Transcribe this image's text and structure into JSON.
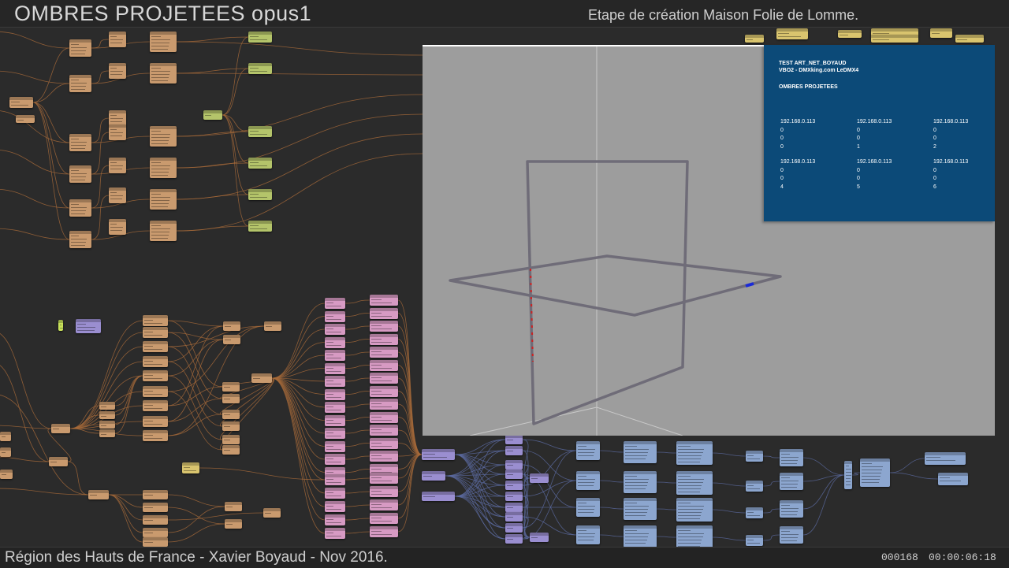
{
  "header": {
    "title": "OMBRES PROJETEES  opus1",
    "subtitle": "Etape de création Maison Folie de Lomme."
  },
  "footer": {
    "credits": "Région des Hauts de France - Xavier Boyaud - Nov 2016.",
    "frame_counter": "000168",
    "timecode": "00:00:06:18"
  },
  "info_panel": {
    "line1": "TEST ART_NET_BOYAUD",
    "line2": "VBO2 - DMXking.com LeDMX4",
    "heading": "OMBRES PROJETEES",
    "row1": [
      {
        "ip": "192.168.0.113",
        "a": "0",
        "b": "0",
        "c": "0"
      },
      {
        "ip": "192.168.0.113",
        "a": "0",
        "b": "0",
        "c": "1"
      },
      {
        "ip": "192.168.0.113",
        "a": "0",
        "b": "0",
        "c": "2"
      }
    ],
    "row2": [
      {
        "ip": "192.168.0.113",
        "a": "0",
        "b": "0",
        "c": "4"
      },
      {
        "ip": "192.168.0.113",
        "a": "0",
        "b": "0",
        "c": "5"
      },
      {
        "ip": "192.168.0.113",
        "a": "0",
        "b": "0",
        "c": "6"
      }
    ]
  },
  "colors": {
    "background": "#2b2b2b",
    "node_tan": "#c99a6e",
    "node_olive": "#b4c46a",
    "node_pink": "#d79ac3",
    "node_purple": "#9a8ed0",
    "node_blue": "#8ca6cf",
    "node_yellow": "#d9c46e",
    "wire_orange": "#a86a3a",
    "wire_blue": "#5b6aa0",
    "preview_bg": "#9d9d9d",
    "panel_bg": "#0c4a78"
  }
}
